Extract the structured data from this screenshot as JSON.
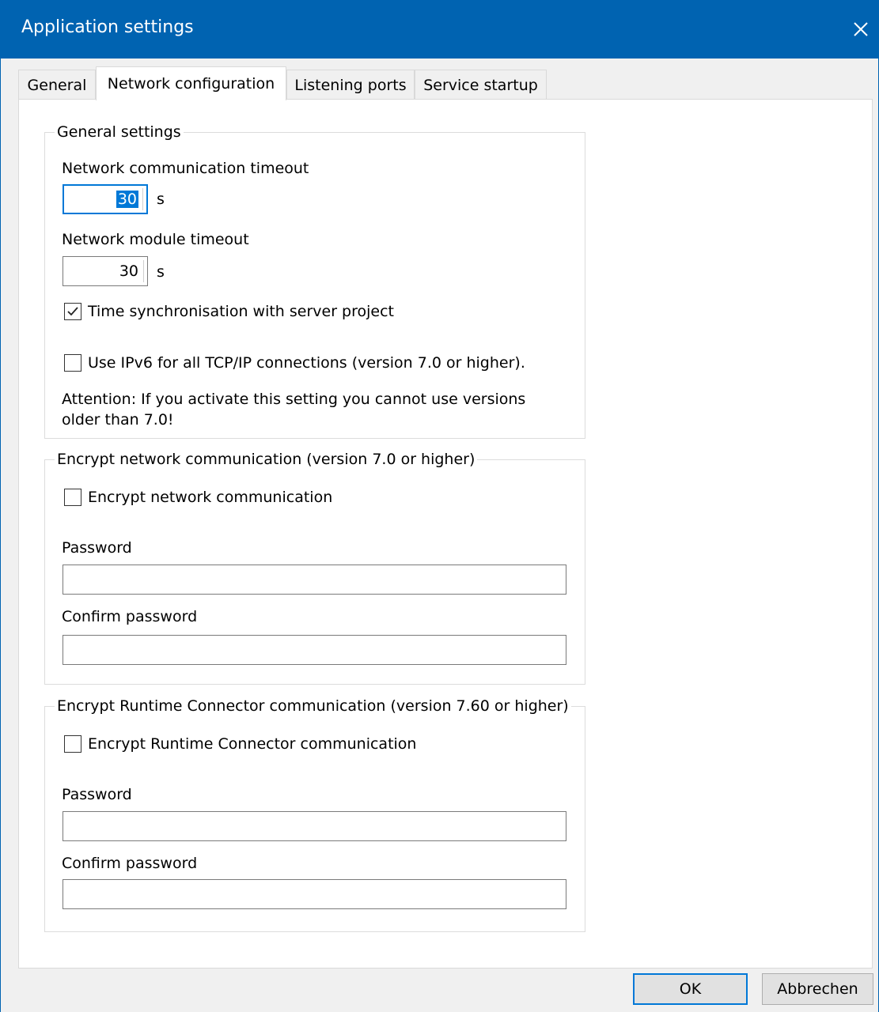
{
  "window": {
    "title": "Application settings",
    "close_icon": "close-icon"
  },
  "tabs": [
    {
      "label": "General",
      "active": false
    },
    {
      "label": "Network configuration",
      "active": true
    },
    {
      "label": "Listening ports",
      "active": false
    },
    {
      "label": "Service startup",
      "active": false
    }
  ],
  "general_settings": {
    "legend": "General settings",
    "comm_timeout_label": "Network communication timeout",
    "comm_timeout_value": "30",
    "comm_timeout_unit": "s",
    "module_timeout_label": "Network module timeout",
    "module_timeout_value": "30",
    "module_timeout_unit": "s",
    "time_sync_label": "Time synchronisation with server project",
    "time_sync_checked": true,
    "ipv6_label": "Use IPv6 for all TCP/IP connections (version 7.0 or higher).",
    "ipv6_checked": false,
    "attention_line1": "Attention: If you activate this setting you cannot use versions",
    "attention_line2": "older than 7.0!"
  },
  "encrypt_network": {
    "legend": "Encrypt network communication (version 7.0 or higher)",
    "checkbox_label": "Encrypt network communication",
    "checked": false,
    "password_label": "Password",
    "password_value": "",
    "confirm_label": "Confirm password",
    "confirm_value": ""
  },
  "encrypt_runtime": {
    "legend": "Encrypt Runtime Connector communication (version 7.60 or higher)",
    "checkbox_label": "Encrypt Runtime Connector communication",
    "checked": false,
    "password_label": "Password",
    "password_value": "",
    "confirm_label": "Confirm password",
    "confirm_value": ""
  },
  "footer": {
    "ok_label": "OK",
    "cancel_label": "Abbrechen"
  },
  "colors": {
    "titlebar": "#0063b1",
    "focus": "#0078d7",
    "dialog_bg": "#f0f0f0",
    "panel_bg": "#ffffff"
  }
}
